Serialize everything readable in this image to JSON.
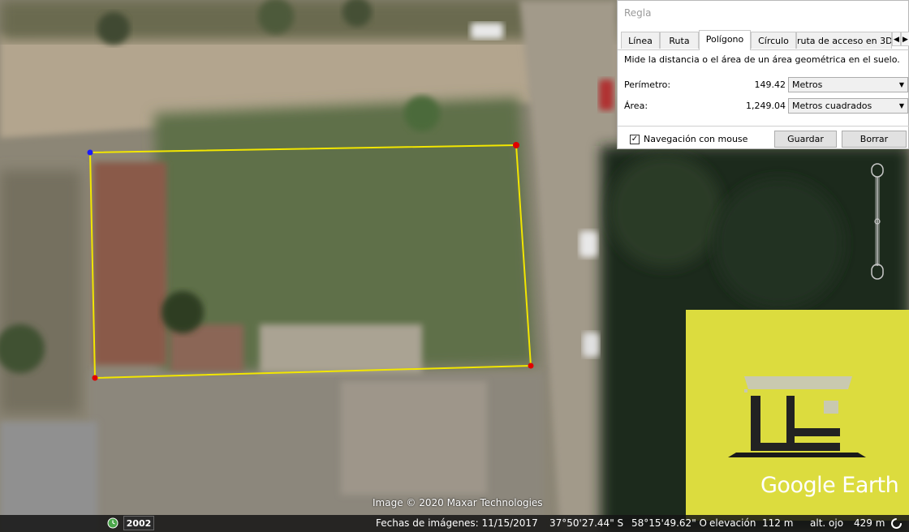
{
  "dialog": {
    "title": "Regla",
    "tabs": [
      "Línea",
      "Ruta",
      "Polígono",
      "Círculo",
      "ruta de acceso en 3D"
    ],
    "active_tab": "Polígono",
    "description": "Mide la distancia o el área de un área geométrica en el suelo.",
    "perimeter": {
      "label": "Perímetro:",
      "value": "149.42",
      "unit": "Metros"
    },
    "area": {
      "label": "Área:",
      "value": "1,249.04",
      "unit": "Metros cuadrados"
    },
    "mouse_nav": {
      "label": "Navegación con mouse",
      "checked": true
    },
    "save_label": "Guardar",
    "clear_label": "Borrar"
  },
  "map": {
    "copyright": "Image © 2020 Maxar Technologies",
    "year_button": "2002",
    "imagery_date": "Fechas de imágenes: 11/15/2017",
    "latitude": "37°50'27.44\" S",
    "longitude": "58°15'49.62\" O",
    "elevation_label": "elevación",
    "elevation_value": "112 m",
    "eye_alt_label": "alt. ojo",
    "eye_alt_value": "429 m",
    "logo_text": "Google Earth"
  },
  "colors": {
    "polygon": "#f2e600",
    "vertex": "#e00000",
    "start_vertex": "#1a1aff",
    "logo_bg": "#dcdc3e"
  }
}
